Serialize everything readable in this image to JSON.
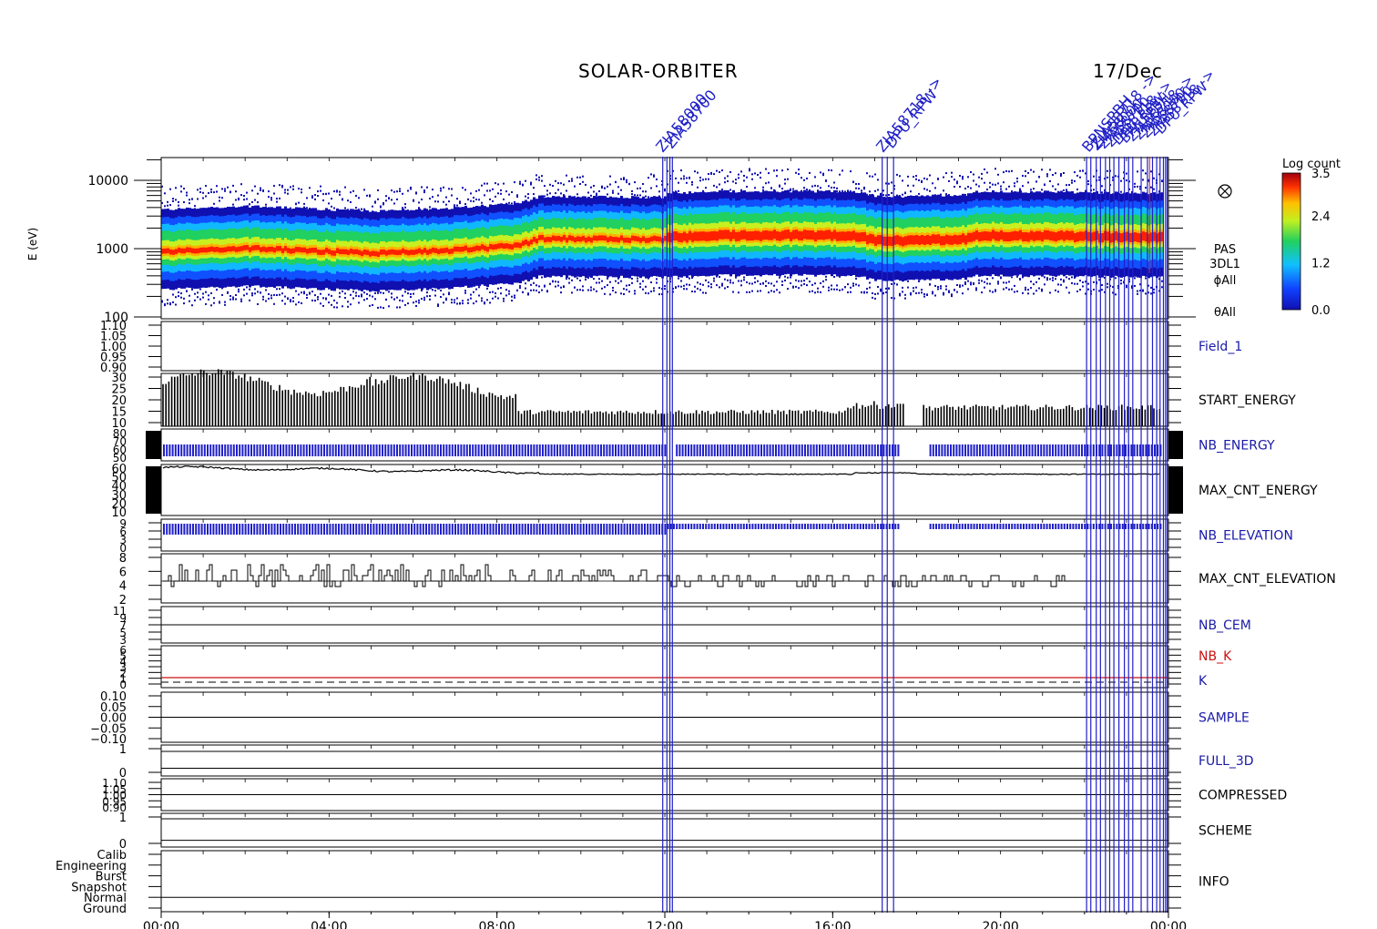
{
  "header": {
    "title": "SOLAR-ORBITER",
    "date": "17/Dec"
  },
  "colors": {
    "axis": "#000000",
    "label_blue": "#1a1aa8",
    "label_black": "#000000",
    "label_red": "#cc1111",
    "event_line": "#2020c8",
    "event_line_red": "#d02020"
  },
  "chart_data": {
    "type": "heatmap",
    "x_axis": {
      "ticks": [
        "00:00",
        "04:00",
        "08:00",
        "12:00",
        "16:00",
        "20:00",
        "00:00"
      ],
      "range_hours": [
        0,
        24
      ]
    },
    "spectrogram": {
      "ylabel": "E (eV)",
      "yscale": "log",
      "ylim": [
        100,
        20000
      ],
      "yticks": [
        "100",
        "1000",
        "10000"
      ],
      "labels": [
        "PAS",
        "3DL1",
        "ϕAll",
        "θAll"
      ],
      "icon": "cross-circle-icon",
      "colorbar": {
        "title": "Log count",
        "ticks": [
          "3.5",
          "2.4",
          "1.2",
          "0.0"
        ],
        "range": [
          0.0,
          3.5
        ]
      },
      "peak_energy_profile": [
        {
          "t": 0,
          "e": 900
        },
        {
          "t": 2,
          "e": 1000
        },
        {
          "t": 3,
          "e": 950
        },
        {
          "t": 5,
          "e": 850
        },
        {
          "t": 7,
          "e": 950
        },
        {
          "t": 8.5,
          "e": 1100
        },
        {
          "t": 9,
          "e": 1400
        },
        {
          "t": 12,
          "e": 1350
        },
        {
          "t": 13.5,
          "e": 1450
        },
        {
          "t": 16.5,
          "e": 1450
        },
        {
          "t": 17,
          "e": 1200
        },
        {
          "t": 19,
          "e": 1250
        },
        {
          "t": 19.5,
          "e": 1450
        },
        {
          "t": 24,
          "e": 1350
        }
      ]
    },
    "panels": [
      {
        "name": "Field_1",
        "color": "blue",
        "yticks": [
          "1.10",
          "1.05",
          "1.00",
          "0.95",
          "0.90"
        ]
      },
      {
        "name": "START_ENERGY",
        "color": "black",
        "yticks": [
          "30",
          "25",
          "20",
          "15",
          "10"
        ],
        "ylim": [
          10,
          30
        ]
      },
      {
        "name": "NB_ENERGY",
        "color": "blue",
        "yticks": [
          "80",
          "70",
          "60",
          "50"
        ],
        "ylim": [
          50,
          80
        ],
        "value": 64
      },
      {
        "name": "MAX_CNT_ENERGY",
        "color": "black",
        "yticks": [
          "60",
          "50",
          "40",
          "30",
          "20",
          "10"
        ],
        "ylim": [
          10,
          60
        ]
      },
      {
        "name": "NB_ELEVATION",
        "color": "blue",
        "yticks": [
          "9",
          "6",
          "3",
          "0"
        ],
        "ylim": [
          0,
          9
        ]
      },
      {
        "name": "MAX_CNT_ELEVATION",
        "color": "black",
        "yticks": [
          "8",
          "6",
          "4",
          "2"
        ],
        "ylim": [
          0,
          9
        ]
      },
      {
        "name": "NB_CEM",
        "color": "blue",
        "yticks": [
          "11",
          "9",
          "7",
          "5",
          "3"
        ],
        "ylim": [
          3,
          11
        ]
      },
      {
        "name": "NB_K",
        "color": "red",
        "yticks": [
          "6",
          "5",
          "4",
          "3",
          "2",
          "1",
          "0"
        ],
        "ylim": [
          0,
          6
        ],
        "extra_label": "K",
        "extra_label_color": "blue"
      },
      {
        "name": "SAMPLE",
        "color": "blue",
        "yticks": [
          "0.10",
          "0.05",
          "0.00",
          "−0.05",
          "−0.10"
        ],
        "ylim": [
          -0.1,
          0.1
        ]
      },
      {
        "name": "FULL_3D",
        "color": "blue",
        "yticks": [
          "1",
          "0"
        ],
        "ylim": [
          0,
          1
        ]
      },
      {
        "name": "COMPRESSED",
        "color": "black",
        "yticks": [
          "1.10",
          "1.05",
          "1.00",
          "0.95",
          "0.90"
        ]
      },
      {
        "name": "SCHEME",
        "color": "black",
        "yticks": [
          "1",
          "0"
        ],
        "ylim": [
          0,
          1
        ]
      },
      {
        "name": "INFO",
        "color": "black",
        "yticks": [
          "Calib",
          "Engineering",
          "Burst",
          "Snapshot",
          "Normal",
          "Ground"
        ]
      }
    ],
    "event_annotations": [
      "ZIA58000",
      "ZIA58700",
      "ZIA58718 ->",
      "DPU_RPW",
      "BPNSPBH",
      "ZIA58718 ->"
    ],
    "event_times_hours": [
      11.95,
      12.05,
      12.12,
      12.18,
      17.18,
      17.3,
      17.45,
      22.05,
      22.15,
      22.28,
      22.38,
      22.5,
      22.6,
      22.7,
      22.82,
      22.95,
      23.05,
      23.15,
      23.35,
      23.5,
      23.62,
      23.72,
      23.8,
      23.88,
      23.93,
      23.97
    ],
    "red_event_time_hours": 23.55
  }
}
